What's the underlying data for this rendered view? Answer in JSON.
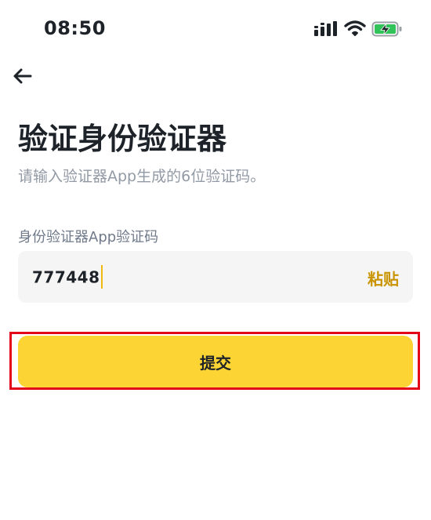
{
  "status_bar": {
    "time": "08:50",
    "icons": [
      "signal-icon",
      "wifi-icon",
      "battery-charging-icon"
    ],
    "battery_color": "#32c25a"
  },
  "nav": {
    "back_icon": "arrow-left-icon"
  },
  "page": {
    "title": "验证身份验证器",
    "subtitle": "请输入验证器App生成的6位验证码。"
  },
  "form": {
    "label": "身份验证器App验证码",
    "code_value": "777448",
    "paste_label": "粘贴",
    "submit_label": "提交"
  },
  "colors": {
    "accent": "#fcd535",
    "paste_text": "#c99400",
    "caret": "#f0b90b",
    "highlight_border": "#e3061b",
    "input_bg": "#f5f5f5"
  }
}
